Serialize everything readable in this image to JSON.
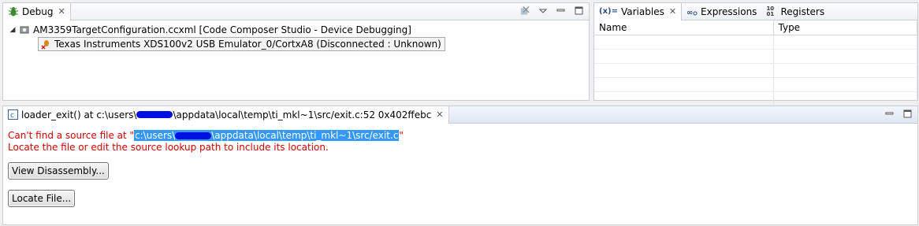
{
  "debug_panel": {
    "tab_label": "Debug",
    "tree": {
      "root_label": "AM3359TargetConfiguration.ccxml [Code Composer Studio - Device Debugging]",
      "child_label": "Texas Instruments XDS100v2 USB Emulator_0/CortxA8 (Disconnected : Unknown)"
    }
  },
  "variables_panel": {
    "tabs": [
      {
        "label": "Variables",
        "icon": "(x)="
      },
      {
        "label": "Expressions",
        "icon": "expressions-icon"
      },
      {
        "label": "Registers",
        "icon": "1010"
      }
    ],
    "columns": [
      "Name",
      "Type"
    ]
  },
  "editor": {
    "tab_label": "loader_exit() at c:\\users\\",
    "tab_label_suffix": "\\appdata\\local\\temp\\ti_mkl~1\\src/exit.c:52 0x402ffebc",
    "error_prefix": "Can't find a source file at \"",
    "error_path_start": "c:\\users\\",
    "error_path_end": "\\appdata\\local\\temp\\ti_mkl~1\\src/exit.c",
    "error_suffix": "\"",
    "error_line2": "Locate the file or edit the source lookup path to include its location.",
    "view_disassembly_label": "View Disassembly...",
    "locate_file_label": "Locate File..."
  },
  "colors": {
    "error_text": "#d40000",
    "selection": "#3399ff",
    "redaction": "#0010e0"
  }
}
